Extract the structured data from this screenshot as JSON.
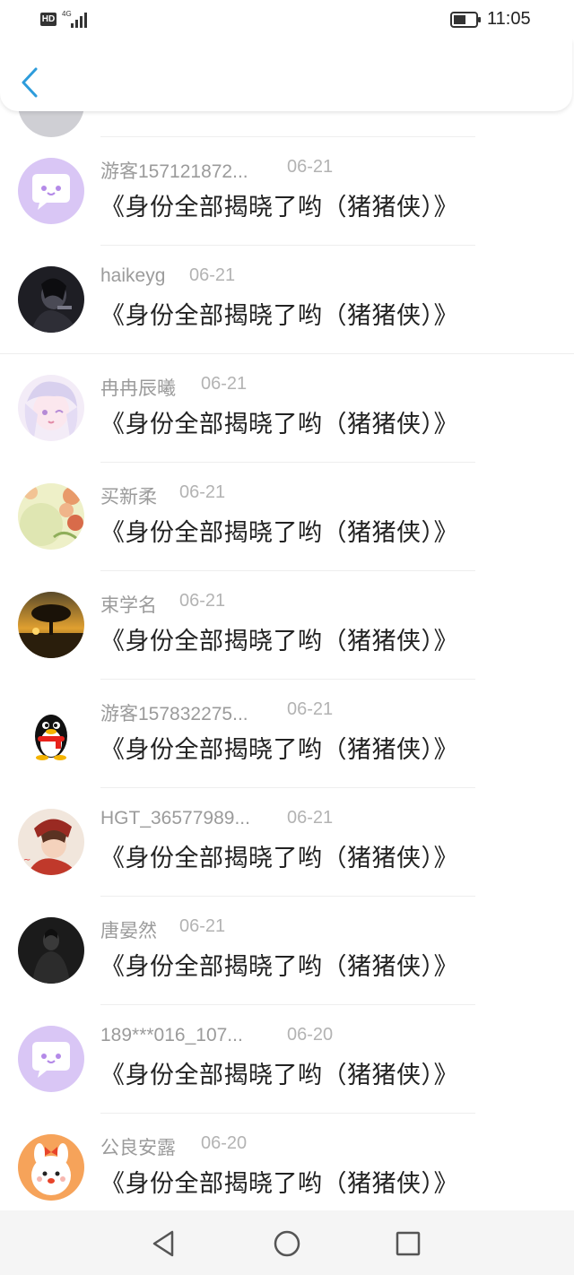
{
  "status_bar": {
    "hd_label": "HD",
    "network_label": "4G",
    "time": "11:05"
  },
  "header": {
    "back_icon": "chevron-left-icon",
    "accent_color": "#2d9cdb"
  },
  "comments": [
    {
      "user": "游客157121872...",
      "date": "06-21",
      "text": "《身份全部揭晓了哟（猪猪侠）》",
      "avatar": "chat-bubble-avatar"
    },
    {
      "user": "haikeyg",
      "date": "06-21",
      "text": "《身份全部揭晓了哟（猪猪侠）》",
      "avatar": "dark-portrait-avatar"
    },
    {
      "user": "冉冉辰曦",
      "date": "06-21",
      "text": "《身份全部揭晓了哟（猪猪侠）》",
      "avatar": "anime-girl-avatar"
    },
    {
      "user": "买新柔",
      "date": "06-21",
      "text": "《身份全部揭晓了哟（猪猪侠）》",
      "avatar": "floral-avatar"
    },
    {
      "user": "束学名",
      "date": "06-21",
      "text": "《身份全部揭晓了哟（猪猪侠）》",
      "avatar": "sunset-tree-avatar"
    },
    {
      "user": "游客157832275...",
      "date": "06-21",
      "text": "《身份全部揭晓了哟（猪猪侠）》",
      "avatar": "penguin-avatar"
    },
    {
      "user": "HGT_36577989...",
      "date": "06-21",
      "text": "《身份全部揭晓了哟（猪猪侠）》",
      "avatar": "anime-character-avatar"
    },
    {
      "user": "唐晏然",
      "date": "06-21",
      "text": "《身份全部揭晓了哟（猪猪侠）》",
      "avatar": "dark-figure-avatar"
    },
    {
      "user": "189***016_107...",
      "date": "06-20",
      "text": "《身份全部揭晓了哟（猪猪侠）》",
      "avatar": "chat-bubble-avatar"
    },
    {
      "user": "公良安露",
      "date": "06-20",
      "text": "《身份全部揭晓了哟（猪猪侠）》",
      "avatar": "cartoon-bunny-avatar"
    }
  ],
  "nav_bar": {
    "back_icon": "triangle-back-icon",
    "home_icon": "circle-home-icon",
    "recents_icon": "square-recents-icon"
  }
}
